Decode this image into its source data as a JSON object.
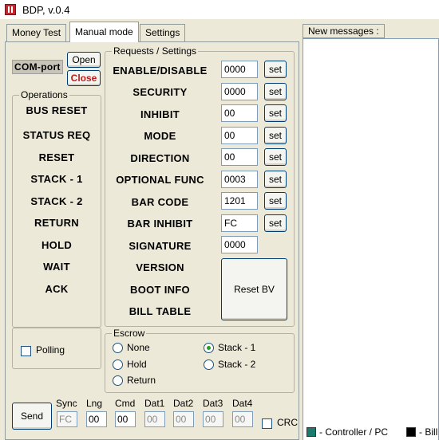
{
  "window": {
    "title": "BDP, v.0.4"
  },
  "tabs": [
    {
      "label": "Money Test"
    },
    {
      "label": "Manual mode"
    },
    {
      "label": "Settings"
    }
  ],
  "com_port": {
    "label": "COM-port",
    "open_label": "Open",
    "close_label": "Close"
  },
  "operations": {
    "title": "Operations",
    "items": [
      "BUS RESET",
      "STATUS REQ",
      "RESET",
      "STACK - 1",
      "STACK - 2",
      "RETURN",
      "HOLD",
      "WAIT",
      "ACK"
    ]
  },
  "requests": {
    "title": "Requests / Settings",
    "rows": [
      {
        "label": "ENABLE/DISABLE",
        "value": "0000",
        "set": "set"
      },
      {
        "label": "SECURITY",
        "value": "0000",
        "set": "set"
      },
      {
        "label": "INHIBIT",
        "value": "00",
        "set": "set"
      },
      {
        "label": "MODE",
        "value": "00",
        "set": "set"
      },
      {
        "label": "DIRECTION",
        "value": "00",
        "set": "set"
      },
      {
        "label": "OPTIONAL FUNC",
        "value": "0003",
        "set": "set"
      },
      {
        "label": "BAR CODE",
        "value": "1201",
        "set": "set"
      },
      {
        "label": "BAR INHIBIT",
        "value": "FC",
        "set": "set"
      },
      {
        "label": "SIGNATURE",
        "value": "0000"
      },
      {
        "label": "VERSION"
      },
      {
        "label": "BOOT INFO"
      },
      {
        "label": "BILL TABLE"
      }
    ],
    "reset_bv": "Reset BV"
  },
  "polling": {
    "label": "Polling",
    "checked": false
  },
  "escrow": {
    "title": "Escrow",
    "options": [
      {
        "label": "None",
        "selected": false
      },
      {
        "label": "Hold",
        "selected": false
      },
      {
        "label": "Return",
        "selected": false
      },
      {
        "label": "Stack - 1",
        "selected": true
      },
      {
        "label": "Stack - 2",
        "selected": false
      }
    ]
  },
  "packet": {
    "send_label": "Send",
    "fields": [
      {
        "label": "Sync",
        "value": "FC",
        "disabled": true
      },
      {
        "label": "Lng",
        "value": "00",
        "disabled": false
      },
      {
        "label": "Cmd",
        "value": "00",
        "disabled": false
      },
      {
        "label": "Dat1",
        "value": "00",
        "disabled": true
      },
      {
        "label": "Dat2",
        "value": "00",
        "disabled": true
      },
      {
        "label": "Dat3",
        "value": "00",
        "disabled": true
      },
      {
        "label": "Dat4",
        "value": "00",
        "disabled": true
      }
    ],
    "crc_label": "CRC",
    "crc_checked": false
  },
  "messages": {
    "header": "New messages :",
    "legend": [
      {
        "label": "- Controller / PC",
        "color": "#1b7a6e"
      },
      {
        "label": "- Bill",
        "color": "#000000"
      }
    ]
  }
}
